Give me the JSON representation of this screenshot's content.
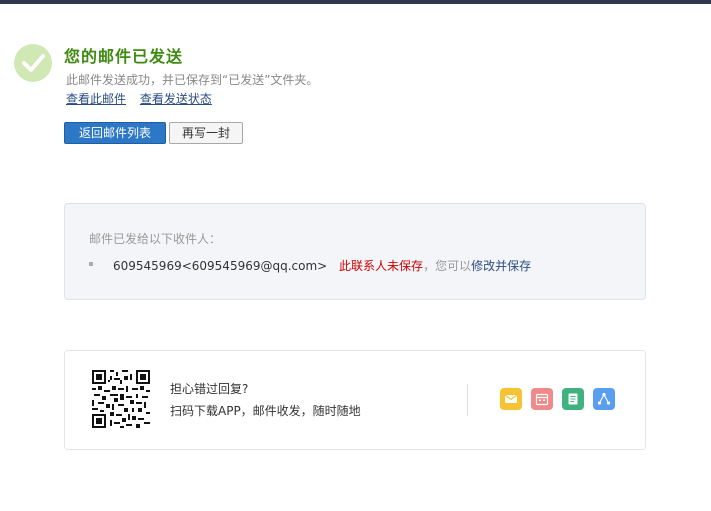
{
  "result": {
    "title": "您的邮件已发送",
    "subtitle": "此邮件发送成功，并已保存到“已发送”文件夹。",
    "links": {
      "view_mail": "查看此邮件",
      "view_status": "查看发送状态"
    }
  },
  "actions": {
    "back_to_list": "返回邮件列表",
    "write_another": "再写一封"
  },
  "recipients": {
    "heading": "邮件已发给以下收件人：",
    "items": [
      {
        "address": "609545969<609545969@qq.com>",
        "unsaved_note": "此联系人未保存",
        "hint": "，您可以",
        "save_link": "修改并保存"
      }
    ]
  },
  "app_promo": {
    "title": "担心错过回复?",
    "description": "扫码下载APP，邮件收发，随时随地",
    "icons": [
      "mail-icon",
      "calendar-icon",
      "note-icon",
      "share-icon"
    ]
  },
  "colors": {
    "topbar": "#2e3a4c",
    "success_green": "#3f8a10",
    "primary_blue": "#2c77c6",
    "link_blue": "#2a4d80",
    "warning_red": "#cc0000"
  }
}
